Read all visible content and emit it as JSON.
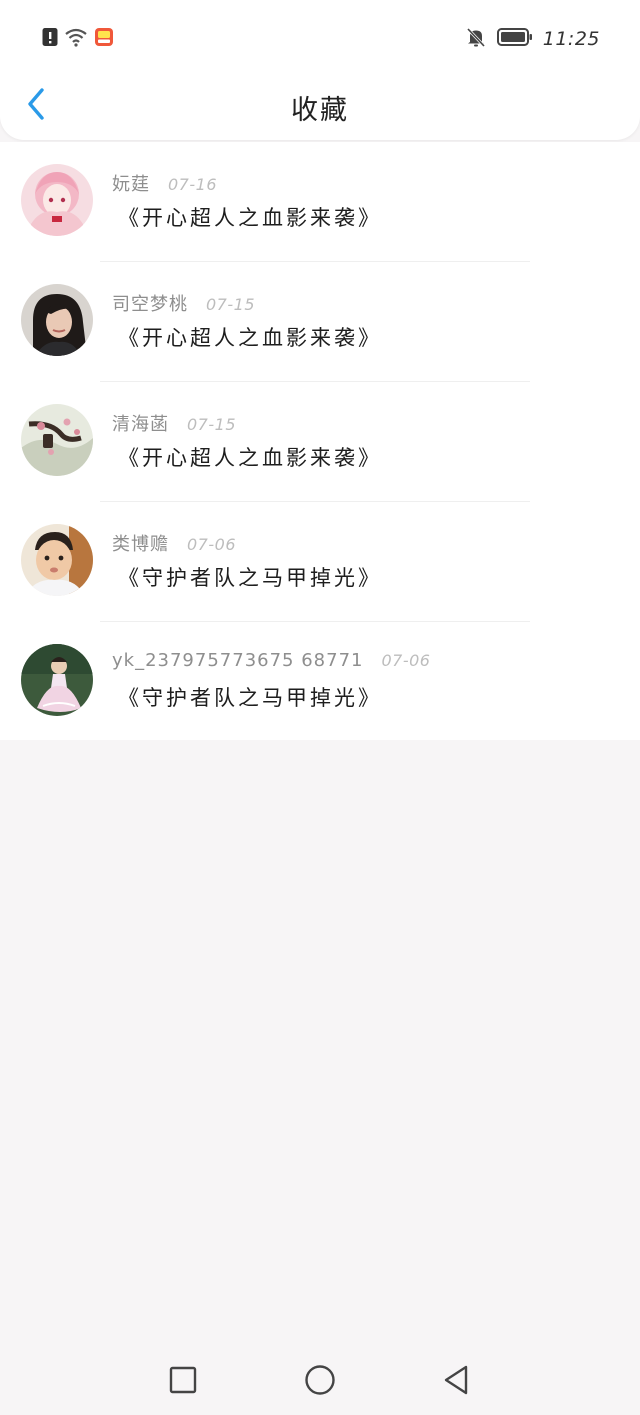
{
  "status_bar": {
    "time": "11:25",
    "left_icons": [
      "alert-icon",
      "wifi-icon",
      "app-notification-icon"
    ],
    "right_icons": [
      "bell-off-icon",
      "battery-icon"
    ]
  },
  "nav": {
    "title": "收藏",
    "back_icon": "chevron-left-icon"
  },
  "favorites": [
    {
      "user": "妧莛",
      "date": "07-16",
      "title": "《开心超人之血影来袭》"
    },
    {
      "user": "司空梦桃",
      "date": "07-15",
      "title": "《开心超人之血影来袭》"
    },
    {
      "user": "清海菡",
      "date": "07-15",
      "title": "《开心超人之血影来袭》"
    },
    {
      "user": "类博赡",
      "date": "07-06",
      "title": "《守护者队之马甲掉光》"
    },
    {
      "user": "yk_237975773675 68771",
      "date": "07-06",
      "title": "《守护者队之马甲掉光》"
    }
  ],
  "system_nav": {
    "icons": [
      "recents-square-icon",
      "home-circle-icon",
      "back-triangle-icon"
    ]
  },
  "colors": {
    "accent": "#2a9ae8",
    "background": "#f7f5f6",
    "list_background": "#ffffff"
  }
}
